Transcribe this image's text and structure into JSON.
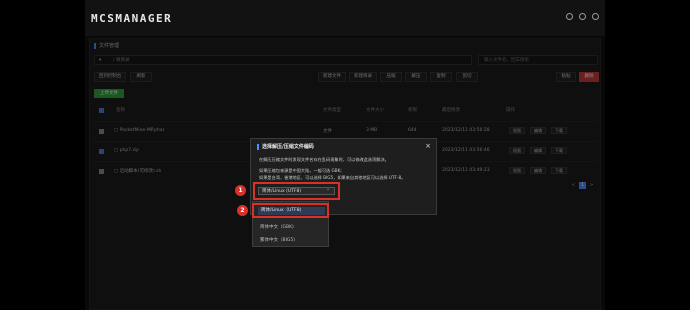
{
  "app": {
    "logo": "MCSMANAGER"
  },
  "panel": {
    "title": "文件管理",
    "path": "/ 根目录",
    "search_placeholder": "输入文件名，回车搜索"
  },
  "toolbar": {
    "left": [
      "回到控制台",
      "刷新"
    ],
    "right": [
      "新建文件",
      "新建目录",
      "压缩",
      "解压",
      "复制",
      "剪切",
      "粘贴",
      "删除"
    ],
    "upload": "上传文件"
  },
  "table": {
    "headers": [
      "名称",
      "文件类型",
      "文件大小",
      "权限",
      "最后修改",
      "操作"
    ],
    "rows": [
      {
        "name": "PocketMine-MP.phar",
        "type": "文件",
        "size": "3 MB",
        "perm": "644",
        "modified": "2023/12/11 03:56:28"
      },
      {
        "name": "php7.zip",
        "type": "文件",
        "size": "15 MB",
        "perm": "644",
        "modified": "2023/12/11 03:56:46"
      },
      {
        "name": "启动脚本(可修改).sh",
        "type": "文件",
        "size": "1 KB",
        "perm": "644",
        "modified": "2023/12/11 03:49:23"
      }
    ],
    "row_actions": [
      "权限",
      "编辑",
      "下载"
    ]
  },
  "pager": {
    "pages": [
      "<",
      "1",
      ">"
    ]
  },
  "modal": {
    "title": "选择解压/压缩文件编码",
    "close": "×",
    "lines": [
      "在解压压缩文件时发现文件名存在乱码现象时，可以修改此选项解决。",
      "如果压缩包来源是中国大陆，一般可选 GBK;",
      "如果是台湾，香港地区，可以选择 BIG5，如果来自其他地区可以选择 UTF-8。"
    ],
    "select_value": "简体/Linux (UTF8)",
    "options": [
      "简体/Linux（UTF8)",
      "简体中文（GBK)",
      "繁体中文（BIG5)"
    ]
  },
  "callouts": [
    "1",
    "2"
  ]
}
